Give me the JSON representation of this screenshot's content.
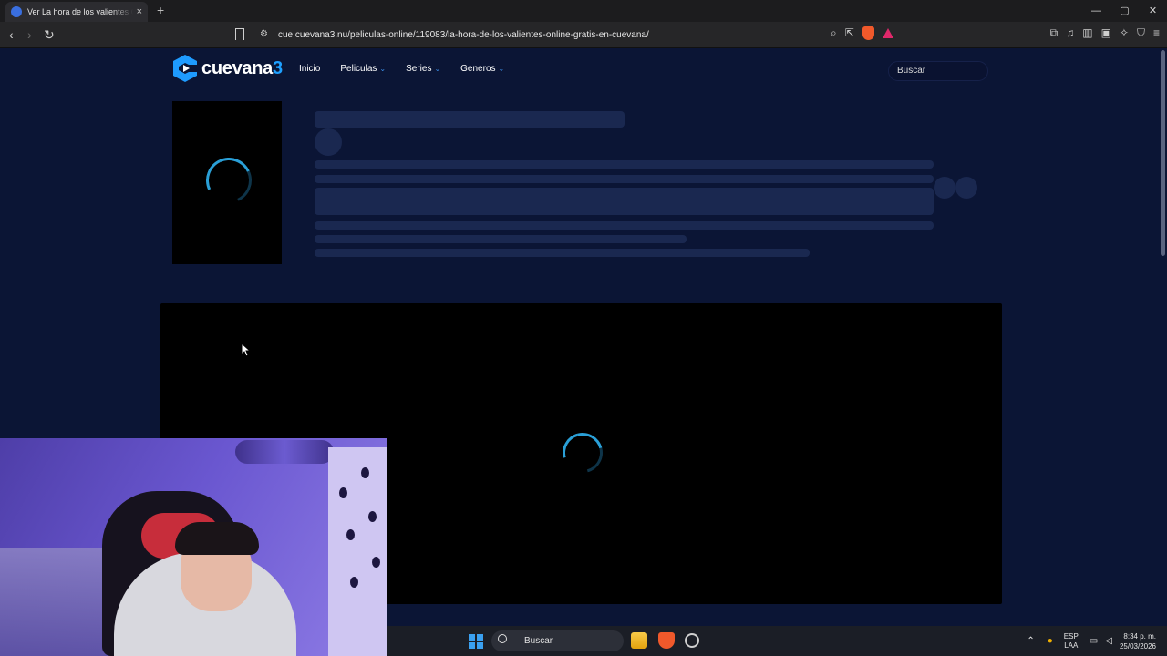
{
  "browser": {
    "tab_title": "Ver La hora de los valientes Online",
    "tab_close": "×",
    "new_tab": "+",
    "url": "cue.cuevana3.nu/peliculas-online/119083/la-hora-de-los-valientes-online-gratis-en-cuevana/",
    "window_controls": {
      "minimize": "—",
      "maximize": "▢",
      "close": "✕"
    },
    "nav": {
      "back": "‹",
      "forward": "›",
      "reload": "↻"
    }
  },
  "site": {
    "logo_text": "cuevana",
    "logo_number": "3",
    "nav_items": [
      {
        "label": "Inicio",
        "dropdown": false
      },
      {
        "label": "Peliculas",
        "dropdown": true
      },
      {
        "label": "Series",
        "dropdown": true
      },
      {
        "label": "Generos",
        "dropdown": true
      }
    ],
    "search_placeholder": "Buscar"
  },
  "taskbar": {
    "search_label": "Buscar",
    "lang_top": "ESP",
    "lang_bottom": "LAA",
    "time": "8:34 p. m.",
    "date": "25/03/2026"
  },
  "colors": {
    "page_bg": "#0b1535",
    "accent": "#1ea0ff",
    "spinner": "#2aa0d8"
  }
}
